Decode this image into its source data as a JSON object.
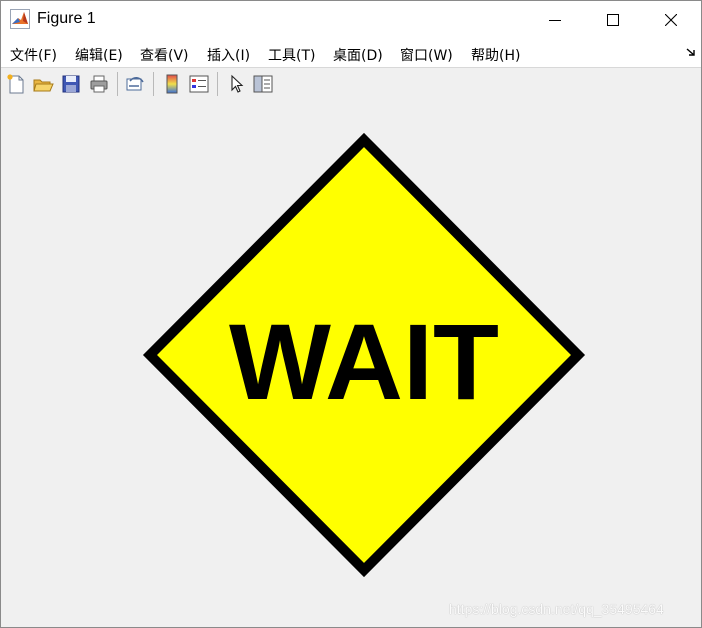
{
  "window": {
    "title": "Figure 1",
    "controls": {
      "minimize": "minimize",
      "maximize": "maximize",
      "close": "close"
    }
  },
  "menubar": {
    "items": [
      "文件(F)",
      "编辑(E)",
      "查看(V)",
      "插入(I)",
      "工具(T)",
      "桌面(D)",
      "窗口(W)",
      "帮助(H)"
    ]
  },
  "toolbar": {
    "buttons": [
      "new-figure-icon",
      "open-file-icon",
      "save-icon",
      "print-icon",
      "link-plot-icon",
      "colorbar-icon",
      "legend-icon",
      "edit-plot-pointer-icon",
      "property-inspector-icon"
    ]
  },
  "figure": {
    "sign_text": "WAIT",
    "sign_fill": "#ffff00",
    "sign_border": "#000000",
    "background": "#f0f0f0"
  },
  "watermark": "https://blog.csdn.net/qq_35495464"
}
